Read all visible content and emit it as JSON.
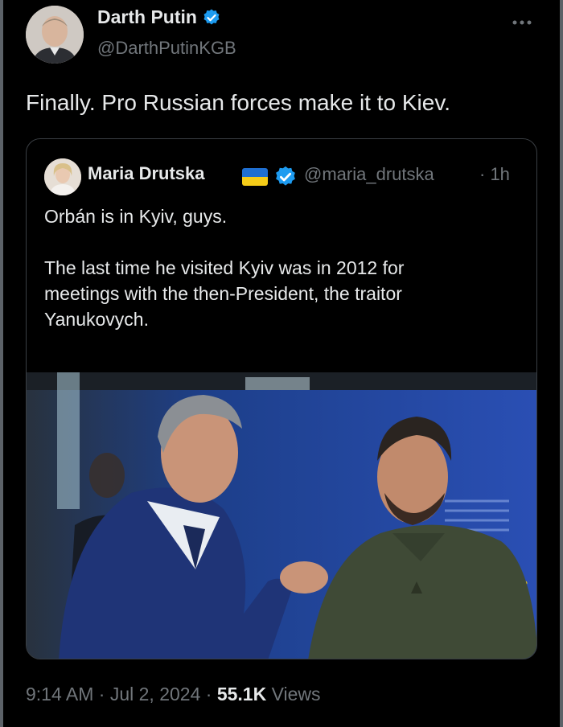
{
  "author": {
    "name": "Darth Putin",
    "handle": "@DarthPutinKGB",
    "verified": true
  },
  "menu_icon": "more-dots-icon",
  "tweet": {
    "text": "Finally. Pro Russian forces make it to Kiev."
  },
  "quoted": {
    "name": "Maria Drutska",
    "flag": "ukraine-flag",
    "verified": true,
    "handle": "@maria_drutska",
    "time": "· 1h",
    "lines": [
      "Orbán is in Kyiv, guys.",
      "The last time he visited Kyiv was in 2012 for",
      "meetings with the then-President, the traitor",
      "Yanukovych."
    ]
  },
  "footer": {
    "time": "9:14 AM",
    "sep1": "·",
    "date": "Jul 2, 2024",
    "sep2": "·",
    "views_count": "55.1K",
    "views_label": "Views"
  },
  "colors": {
    "background": "#000000",
    "text": "#e7e9ea",
    "muted": "#71767b",
    "verified": "#1d9bf0",
    "border": "#3a3f44"
  }
}
